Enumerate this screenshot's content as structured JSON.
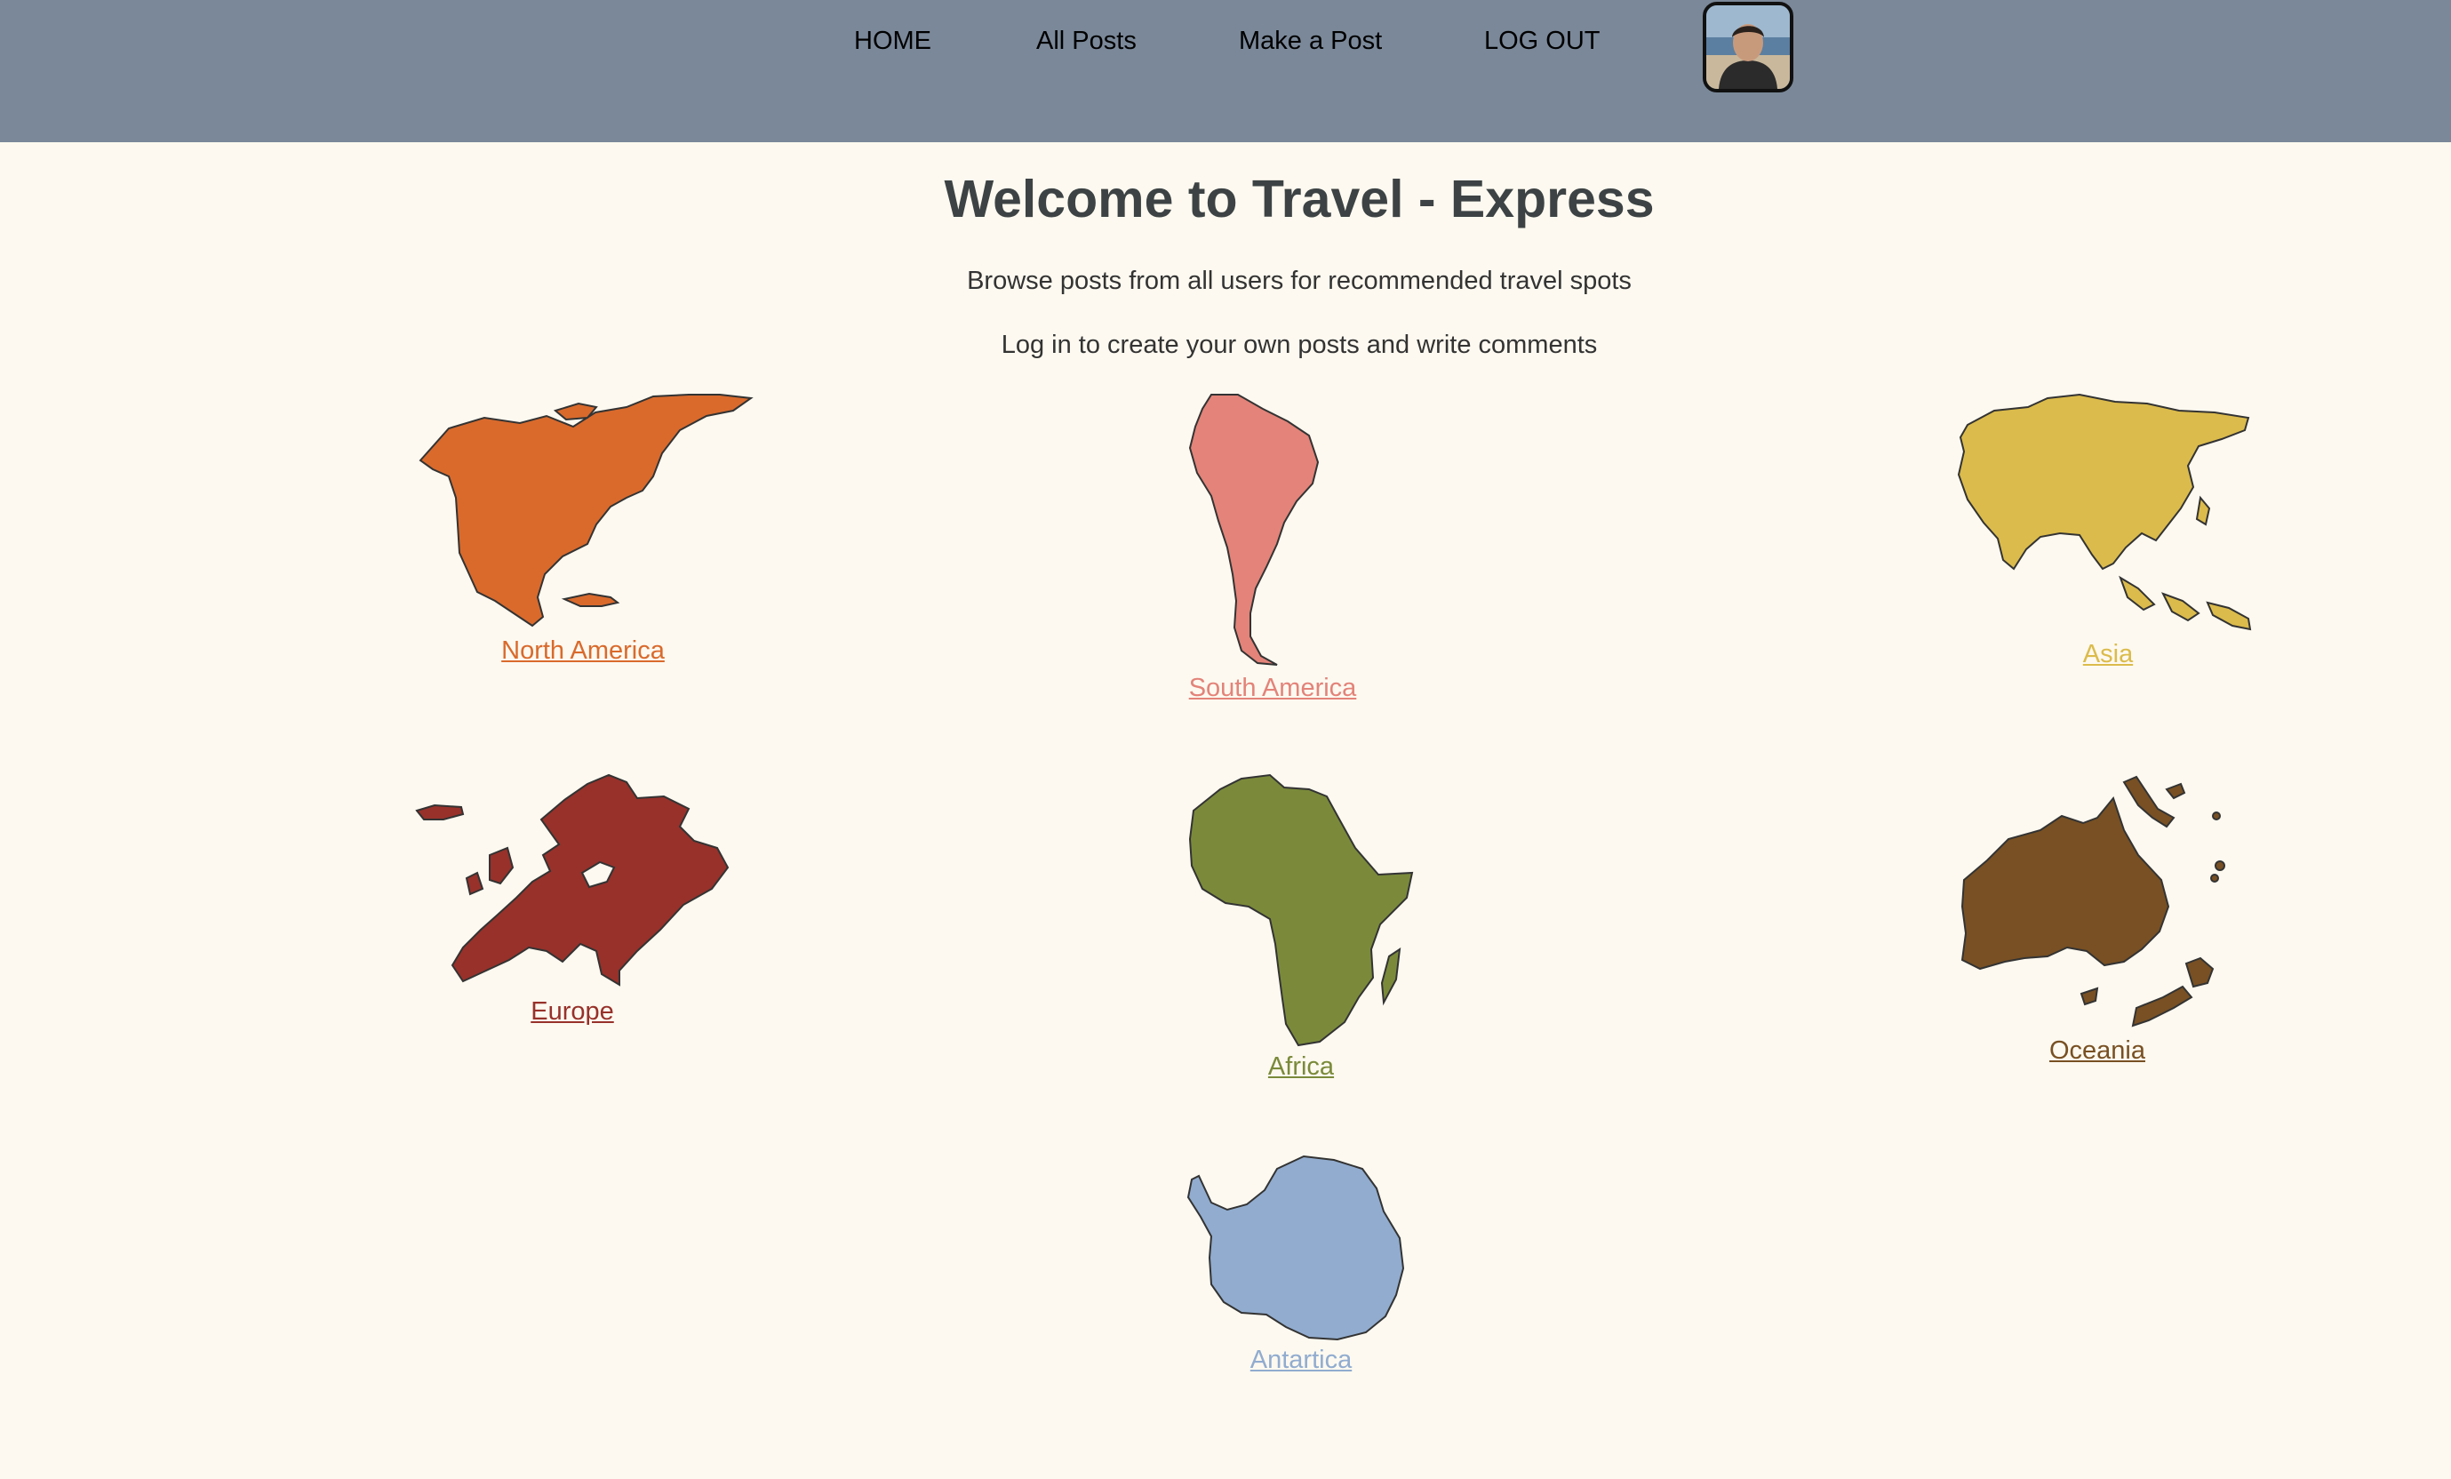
{
  "nav": {
    "home": "HOME",
    "all_posts": "All Posts",
    "make_post": "Make a Post",
    "logout": "LOG OUT"
  },
  "header": {
    "title": "Welcome to Travel - Express",
    "line1": "Browse posts from all users for recommended travel spots",
    "line2": "Log in to create your own posts and write comments"
  },
  "continents": {
    "north_america": {
      "label": "North America",
      "color": "#d96a2c"
    },
    "south_america": {
      "label": "South America",
      "color": "#e38379"
    },
    "asia": {
      "label": "Asia",
      "color": "#dbbb4b"
    },
    "europe": {
      "label": "Europe",
      "color": "#97312a"
    },
    "africa": {
      "label": "Africa",
      "color": "#7a8a3a"
    },
    "oceania": {
      "label": "Oceania",
      "color": "#785023"
    },
    "antarctica": {
      "label": "Antartica",
      "color": "#91accf"
    }
  },
  "colors": {
    "navbar": "#7a8899",
    "background": "#fdf9f0"
  }
}
